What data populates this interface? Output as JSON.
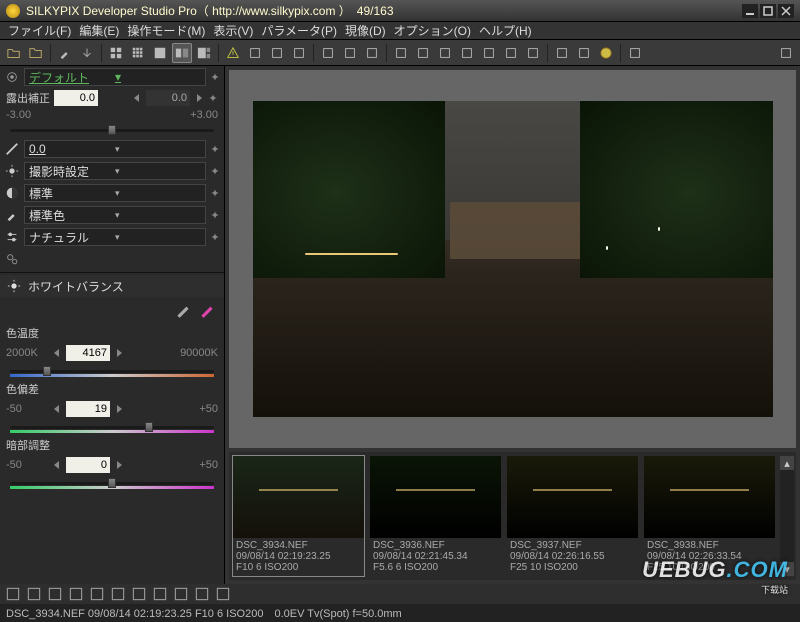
{
  "title": "SILKYPIX Developer Studio Pro（ http://www.silkypix.com ）　49/163",
  "menu": [
    "ファイル(F)",
    "編集(E)",
    "操作モード(M)",
    "表示(V)",
    "パラメータ(P)",
    "現像(D)",
    "オプション(O)",
    "ヘルプ(H)"
  ],
  "toolbar_icons": [
    "folder-open-icon",
    "folder-icon",
    "eyedropper-icon",
    "arrow-down-icon",
    "grid4-icon",
    "grid9-icon",
    "single-view-icon",
    "compare-icon",
    "mixed-view-icon",
    "warning-icon",
    "grid-overlay-icon",
    "split-h-icon",
    "split-v-icon",
    "wand-icon",
    "pointer-icon",
    "brush-icon",
    "scissor-icon",
    "rotate-left-icon",
    "rotate-right-icon",
    "crop-icon",
    "clone-icon",
    "stamp-icon",
    "levels-icon",
    "printer-icon",
    "hammer-icon",
    "coin-icon",
    "scroll-right-icon",
    "menu-more-icon"
  ],
  "top_panel": {
    "preset_label": "デフォルト",
    "exposure_label": "露出補正",
    "exposure_valA": "0.0",
    "exposure_valB": "0.0",
    "exposure_min": "-3.00",
    "exposure_max": "+3.00",
    "contrast_value": "0.0",
    "rows": [
      {
        "icon": "sun-icon",
        "label": "撮影時設定"
      },
      {
        "icon": "contrast-icon",
        "label": "標準"
      },
      {
        "icon": "brush-sm-icon",
        "label": "標準色"
      },
      {
        "icon": "sliders-icon",
        "label": "ナチュラル"
      }
    ]
  },
  "wb_panel": {
    "title": "ホワイトバランス",
    "preset_icon_a": "picker-gray-icon",
    "preset_icon_b": "picker-skin-icon",
    "temp_label": "色温度",
    "temp_value": "4167",
    "temp_min": "2000K",
    "temp_max": "90000K",
    "tint_label": "色偏差",
    "tint_value": "19",
    "tint_min": "-50",
    "tint_max": "+50",
    "dark_label": "暗部調整",
    "dark_value": "0",
    "dark_min": "-50",
    "dark_max": "+50"
  },
  "thumbs": [
    {
      "name": "DSC_3934.NEF",
      "date": "09/08/14 02:19:23.25",
      "exif": "F10 6 ISO200"
    },
    {
      "name": "DSC_3936.NEF",
      "date": "09/08/14 02:21:45.34",
      "exif": "F5.6 6 ISO200"
    },
    {
      "name": "DSC_3937.NEF",
      "date": "09/08/14 02:26:16.55",
      "exif": "F25 10 ISO200"
    },
    {
      "name": "DSC_3938.NEF",
      "date": "09/08/14 02:26:33.54",
      "exif": "F25 10 ISO200"
    }
  ],
  "bottombar_icons": [
    "filter-icon",
    "layers-icon",
    "zoom-icon",
    "hand-icon",
    "compare-b-icon",
    "screen-icon",
    "fx-icon",
    "rotate-icon",
    "info-icon",
    "expand-icon",
    "shrink-icon"
  ],
  "status": "DSC_3934.NEF 09/08/14 02:19:23.25 F10 6 ISO200　0.0EV Tv(Spot) f=50.0mm",
  "watermark": "UEBUG",
  "watermark_sub": "下载站"
}
